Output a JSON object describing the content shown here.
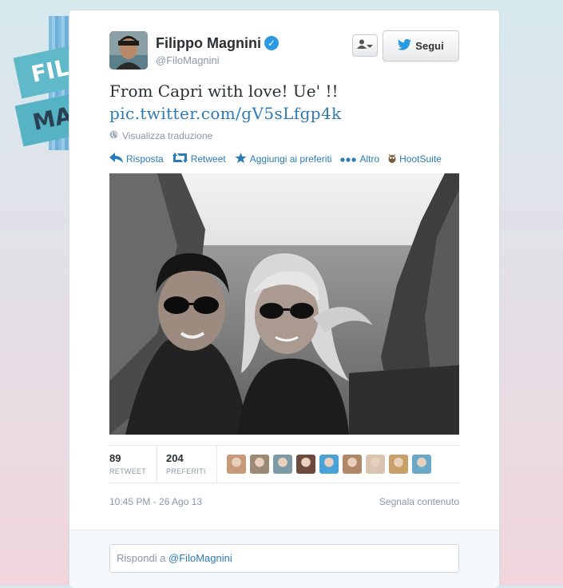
{
  "background": {
    "banner_line1": "FILI",
    "banner_line2": "MAGN"
  },
  "tweet": {
    "user": {
      "name": "Filippo Magnini",
      "handle": "@FiloMagnini",
      "verified": true,
      "verified_glyph": "✓"
    },
    "follow_button_label": "Segui",
    "text": "From Capri with love! Ue' !!",
    "link": "pic.twitter.com/gV5sLfgp4k",
    "translate_label": "Visualizza traduzione",
    "actions": {
      "reply": "Risposta",
      "retweet": "Retweet",
      "favorite": "Aggiungi ai preferiti",
      "more": "Altro",
      "hootsuite": "HootSuite"
    },
    "stats": {
      "retweets": {
        "value": "89",
        "label": "RETWEET"
      },
      "favorites": {
        "value": "204",
        "label": "PREFERITI"
      }
    },
    "favoriters_colors": [
      "#c89a7a",
      "#9c8a76",
      "#7e9aa6",
      "#6e4a3c",
      "#4aa3d6",
      "#b08868",
      "#d8c4b0",
      "#c9a06a",
      "#6aa8c8"
    ],
    "timestamp": "10:45 PM - 26 Ago 13",
    "report_label": "Segnala contenuto"
  },
  "reply": {
    "prefix": "Rispondi a ",
    "mention": "@FiloMagnini"
  },
  "colors": {
    "link_blue": "#2b7bb9",
    "verified_blue": "#2a9ae4",
    "muted_gray": "#8899a6"
  }
}
